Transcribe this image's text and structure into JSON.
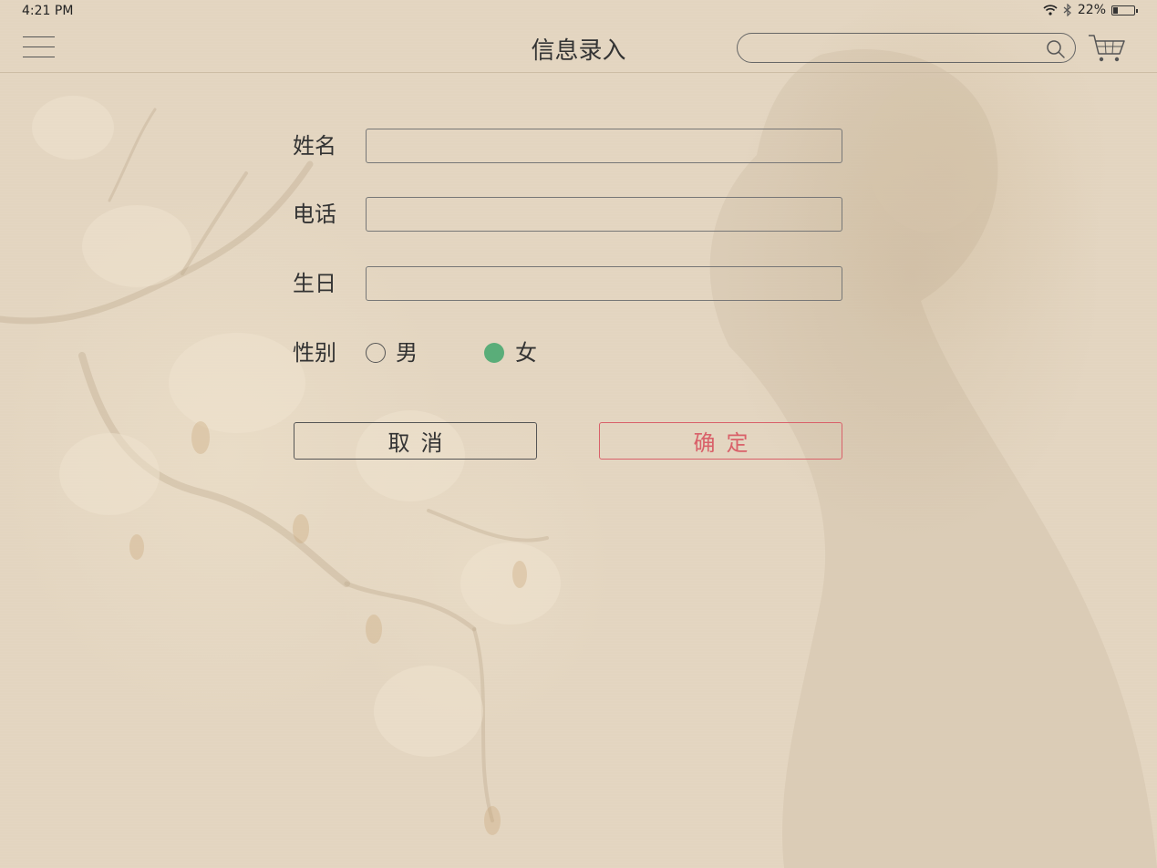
{
  "status_bar": {
    "time": "4:21 PM",
    "battery": "22%",
    "battery_level": 0.22,
    "wifi_icon": "wifi-icon",
    "bluetooth_icon": "bluetooth-icon"
  },
  "nav": {
    "title": "信息录入",
    "menu_icon": "hamburger-menu-icon",
    "search_placeholder": "",
    "search_icon": "search-icon",
    "cart_icon": "shopping-cart-icon"
  },
  "form": {
    "name_label": "姓名",
    "name_value": "",
    "phone_label": "电话",
    "phone_value": "",
    "birthday_label": "生日",
    "birthday_value": "",
    "gender_label": "性别",
    "gender_options": [
      {
        "label": "男",
        "selected": false
      },
      {
        "label": "女",
        "selected": true
      }
    ],
    "cancel_label": "取消",
    "confirm_label": "确定"
  },
  "colors": {
    "background": "#e3d5c0",
    "text": "#333333",
    "radio_selected": "#5aad79",
    "confirm": "#d9616a",
    "divider": "#cdbda5"
  }
}
